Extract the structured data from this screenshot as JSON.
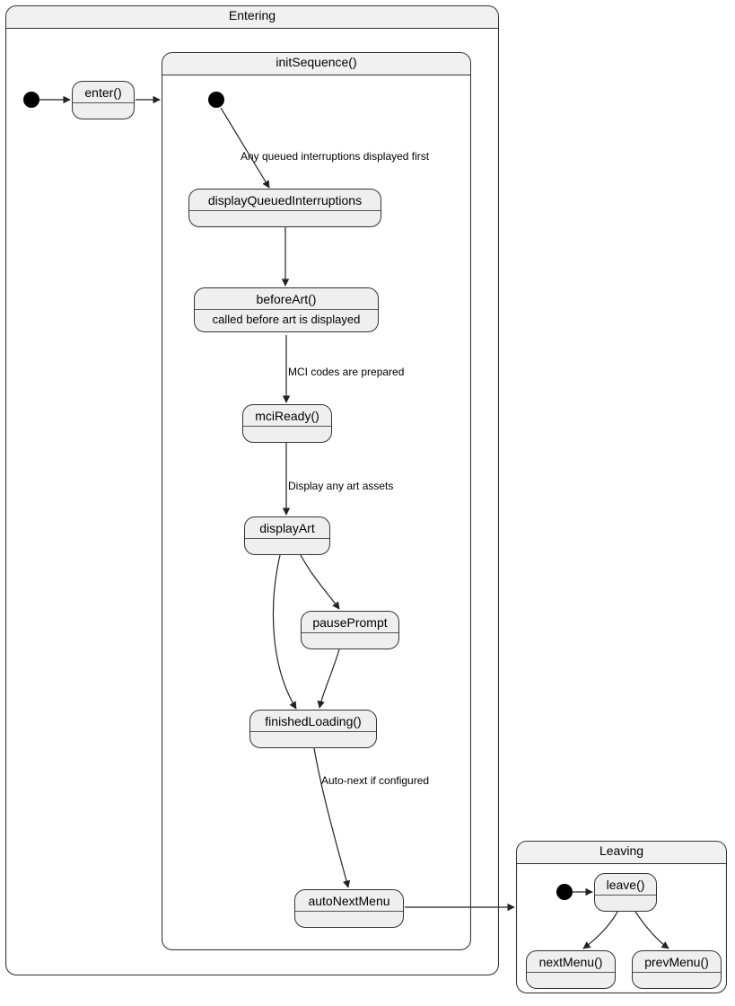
{
  "containers": {
    "entering": {
      "title": "Entering"
    },
    "initSequence": {
      "title": "initSequence()"
    },
    "leaving": {
      "title": "Leaving"
    }
  },
  "states": {
    "enter": {
      "title": "enter()",
      "body": ""
    },
    "displayQueuedInterruptions": {
      "title": "displayQueuedInterruptions",
      "body": ""
    },
    "beforeArt": {
      "title": "beforeArt()",
      "body": "called before art is displayed"
    },
    "mciReady": {
      "title": "mciReady()",
      "body": ""
    },
    "displayArt": {
      "title": "displayArt",
      "body": ""
    },
    "pausePrompt": {
      "title": "pausePrompt",
      "body": ""
    },
    "finishedLoading": {
      "title": "finishedLoading()",
      "body": ""
    },
    "autoNextMenu": {
      "title": "autoNextMenu",
      "body": ""
    },
    "leave": {
      "title": "leave()",
      "body": ""
    },
    "nextMenu": {
      "title": "nextMenu()",
      "body": ""
    },
    "prevMenu": {
      "title": "prevMenu()",
      "body": ""
    }
  },
  "edges": {
    "queued": "Any queued interruptions displayed first",
    "mci": "MCI codes are prepared",
    "art": "Display any art assets",
    "autonext": "Auto-next if configured"
  },
  "chart_data": {
    "type": "state-diagram",
    "containers": [
      {
        "id": "Entering",
        "label": "Entering",
        "children": [
          "enter",
          "initSequence"
        ]
      },
      {
        "id": "initSequence",
        "label": "initSequence()",
        "parent": "Entering",
        "children": [
          "displayQueuedInterruptions",
          "beforeArt",
          "mciReady",
          "displayArt",
          "pausePrompt",
          "finishedLoading",
          "autoNextMenu"
        ]
      },
      {
        "id": "Leaving",
        "label": "Leaving",
        "children": [
          "leave",
          "nextMenu",
          "prevMenu"
        ]
      }
    ],
    "states": [
      {
        "id": "enter",
        "label": "enter()"
      },
      {
        "id": "displayQueuedInterruptions",
        "label": "displayQueuedInterruptions"
      },
      {
        "id": "beforeArt",
        "label": "beforeArt()",
        "note": "called before art is displayed"
      },
      {
        "id": "mciReady",
        "label": "mciReady()"
      },
      {
        "id": "displayArt",
        "label": "displayArt"
      },
      {
        "id": "pausePrompt",
        "label": "pausePrompt"
      },
      {
        "id": "finishedLoading",
        "label": "finishedLoading()"
      },
      {
        "id": "autoNextMenu",
        "label": "autoNextMenu"
      },
      {
        "id": "leave",
        "label": "leave()"
      },
      {
        "id": "nextMenu",
        "label": "nextMenu()"
      },
      {
        "id": "prevMenu",
        "label": "prevMenu()"
      }
    ],
    "initial": [
      {
        "in": "Entering",
        "to": "enter"
      },
      {
        "in": "initSequence",
        "to": "displayQueuedInterruptions"
      },
      {
        "in": "Leaving",
        "to": "leave"
      }
    ],
    "transitions": [
      {
        "from": "enter",
        "to": "initSequence"
      },
      {
        "from": "initSequence.initial",
        "to": "displayQueuedInterruptions",
        "label": "Any queued interruptions displayed first"
      },
      {
        "from": "displayQueuedInterruptions",
        "to": "beforeArt"
      },
      {
        "from": "beforeArt",
        "to": "mciReady",
        "label": "MCI codes are prepared"
      },
      {
        "from": "mciReady",
        "to": "displayArt",
        "label": "Display any art assets"
      },
      {
        "from": "displayArt",
        "to": "pausePrompt"
      },
      {
        "from": "displayArt",
        "to": "finishedLoading"
      },
      {
        "from": "pausePrompt",
        "to": "finishedLoading"
      },
      {
        "from": "finishedLoading",
        "to": "autoNextMenu",
        "label": "Auto-next if configured"
      },
      {
        "from": "autoNextMenu",
        "to": "Leaving"
      },
      {
        "from": "leave",
        "to": "nextMenu"
      },
      {
        "from": "leave",
        "to": "prevMenu"
      }
    ]
  }
}
